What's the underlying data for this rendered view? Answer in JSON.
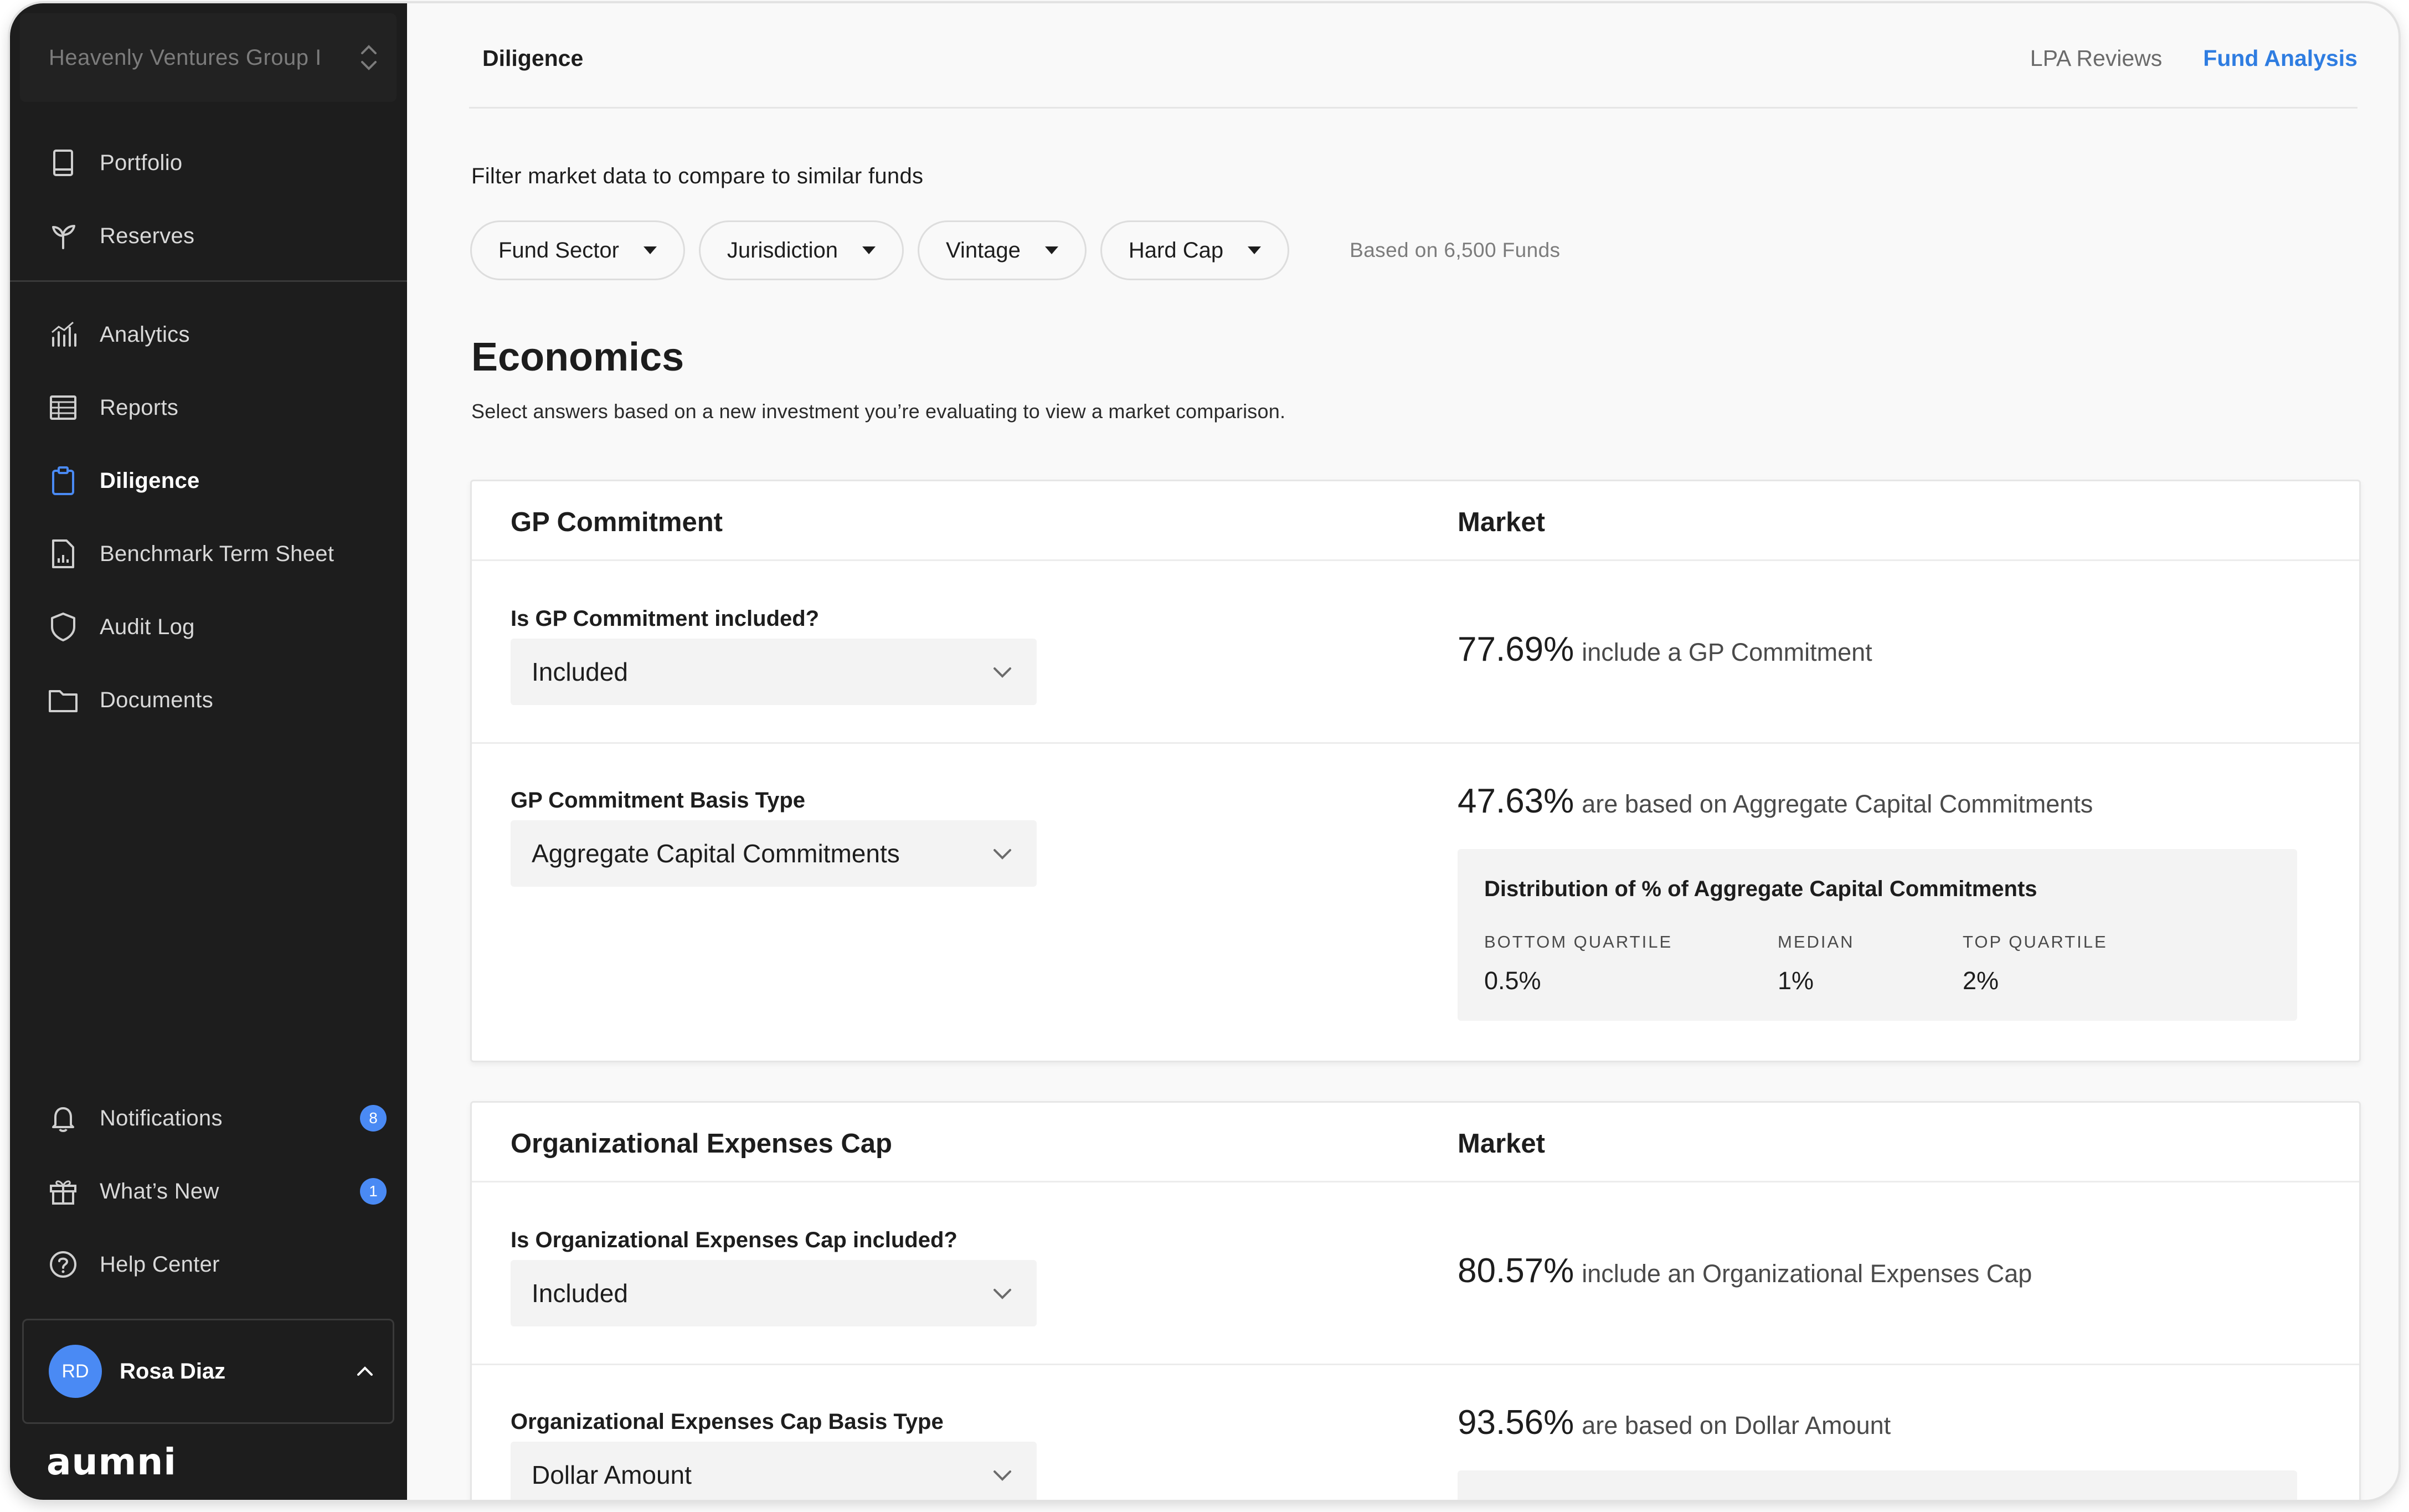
{
  "sidebar": {
    "org_name": "Heavenly Ventures Group I",
    "group1": [
      {
        "label": "Portfolio",
        "icon": "book-icon"
      },
      {
        "label": "Reserves",
        "icon": "sprout-icon"
      }
    ],
    "group2": [
      {
        "label": "Analytics",
        "icon": "bar-chart-icon"
      },
      {
        "label": "Reports",
        "icon": "table-icon"
      },
      {
        "label": "Diligence",
        "icon": "clipboard-icon",
        "active": true
      },
      {
        "label": "Benchmark Term Sheet",
        "icon": "document-chart-icon"
      },
      {
        "label": "Audit Log",
        "icon": "shield-icon"
      },
      {
        "label": "Documents",
        "icon": "folder-icon"
      }
    ],
    "bottom": [
      {
        "label": "Notifications",
        "icon": "bell-icon",
        "badge": "8"
      },
      {
        "label": "What’s New",
        "icon": "gift-icon",
        "badge": "1"
      },
      {
        "label": "Help Center",
        "icon": "help-circle-icon"
      }
    ],
    "user": {
      "initials": "RD",
      "name": "Rosa Diaz"
    },
    "logo": "aumni",
    "accent_color": "#4a8af4"
  },
  "header": {
    "breadcrumb": "Diligence",
    "links": [
      {
        "label": "LPA Reviews",
        "active": false
      },
      {
        "label": "Fund Analysis",
        "active": true
      }
    ],
    "active_link_color": "#2f7de1"
  },
  "filters": {
    "title": "Filter market data to compare to similar funds",
    "pills": [
      "Fund Sector",
      "Jurisdiction",
      "Vintage",
      "Hard Cap"
    ],
    "note": "Based on 6,500 Funds"
  },
  "economics": {
    "title": "Economics",
    "subtitle": "Select answers based on a new investment you’re evaluating to view a market comparison."
  },
  "cards": [
    {
      "title": "GP Commitment",
      "market_label": "Market",
      "rows": [
        {
          "question": "Is GP Commitment included?",
          "answer": "Included",
          "stat_pct": "77.69%",
          "stat_desc": "include a GP Commitment"
        },
        {
          "question": "GP Commitment Basis Type",
          "answer": "Aggregate Capital Commitments",
          "stat_pct": "47.63%",
          "stat_desc": "are based on Aggregate Capital Commitments",
          "distribution": {
            "title": "Distribution of % of Aggregate Capital Commitments",
            "cols": [
              {
                "key": "BOTTOM QUARTILE",
                "value": "0.5%"
              },
              {
                "key": "MEDIAN",
                "value": "1%"
              },
              {
                "key": "TOP QUARTILE",
                "value": "2%"
              }
            ]
          }
        }
      ]
    },
    {
      "title": "Organizational Expenses Cap",
      "market_label": "Market",
      "rows": [
        {
          "question": "Is Organizational Expenses Cap included?",
          "answer": "Included",
          "stat_pct": "80.57%",
          "stat_desc": "include an Organizational Expenses Cap"
        },
        {
          "question": "Organizational Expenses Cap Basis Type",
          "answer": "Dollar Amount",
          "stat_pct": "93.56%",
          "stat_desc": "are based on Dollar Amount"
        }
      ]
    }
  ]
}
